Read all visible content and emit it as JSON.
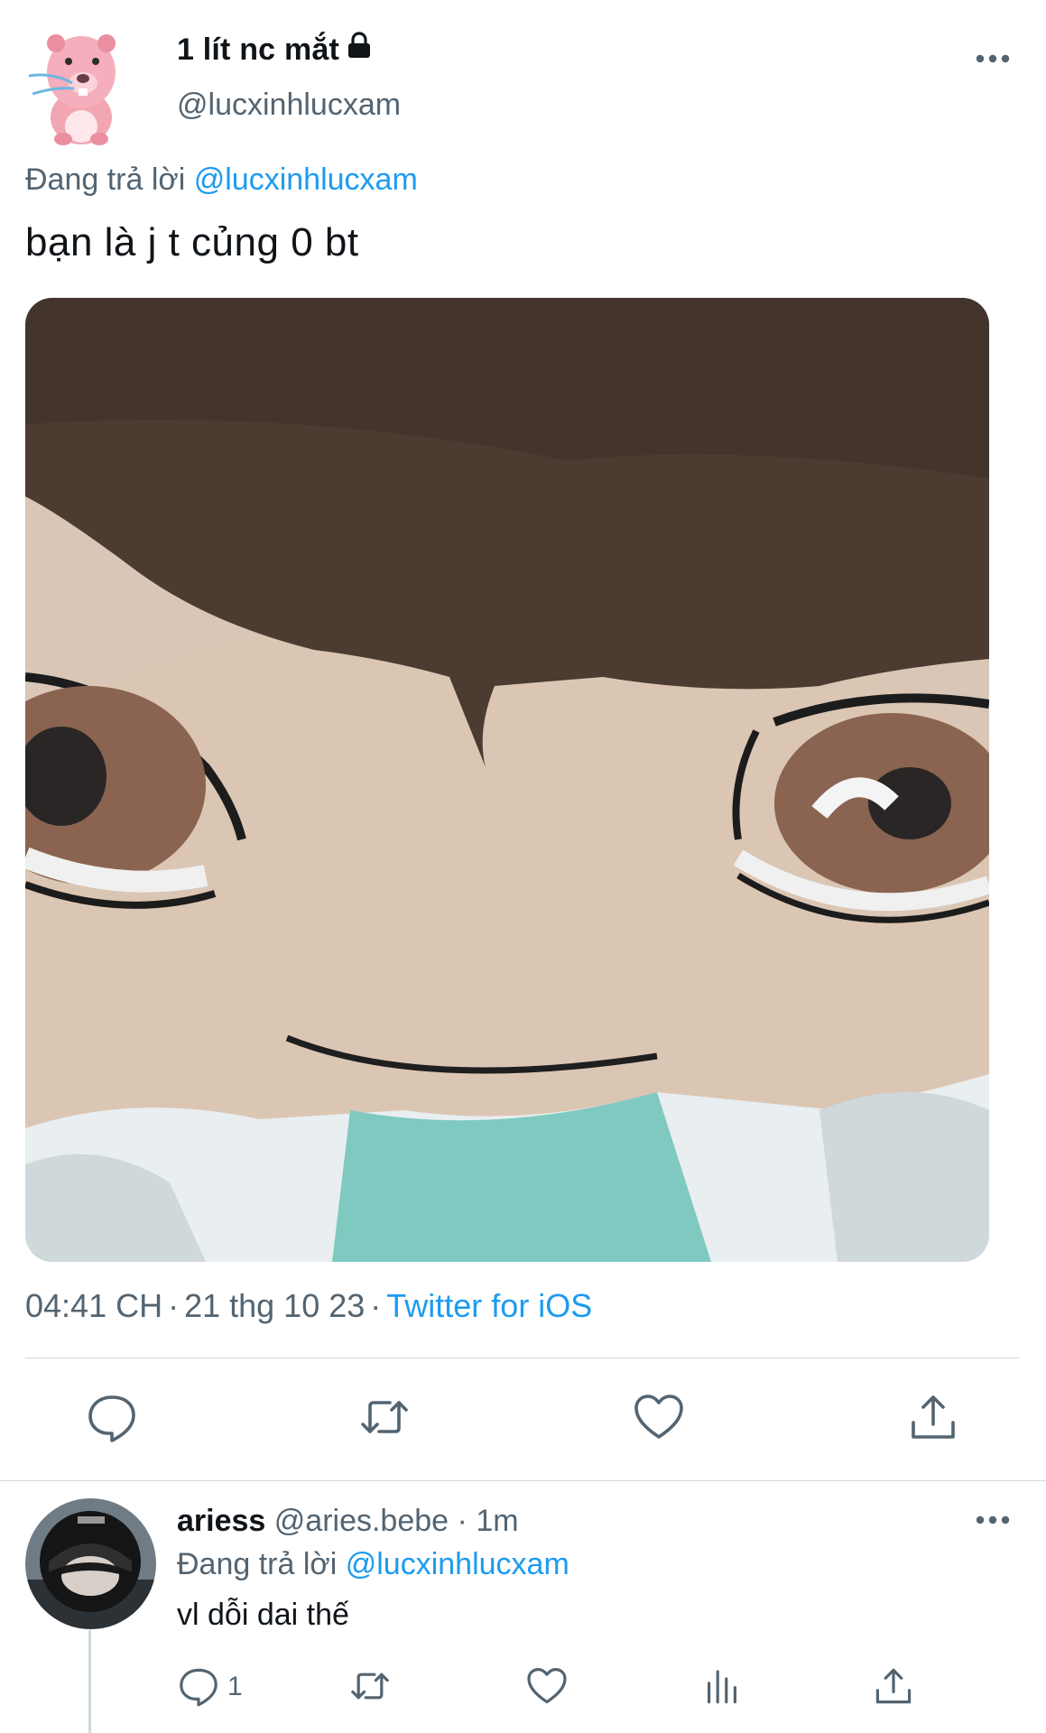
{
  "tweet": {
    "display_name": "1 lít nc mắt",
    "handle": "@lucxinhlucxam",
    "reply_prefix": "Đang trả lời",
    "reply_to": "@lucxinhlucxam",
    "text": "bạn là j t củng 0 bt",
    "time": "04:41 CH",
    "date": "21 thg 10 23",
    "source": "Twitter for iOS",
    "separator": "·"
  },
  "reply": {
    "display_name": "ariess",
    "handle": "@aries.bebe",
    "separator": "·",
    "time": "1m",
    "reply_prefix": "Đang trả lời",
    "reply_to": "@lucxinhlucxam",
    "text": "vl dỗi dai thế",
    "reply_count": "1"
  },
  "icons": {
    "lock": "lock-icon",
    "more": "more-icon",
    "reply": "reply-icon",
    "retweet": "retweet-icon",
    "like": "heart-icon",
    "share": "share-icon",
    "views": "views-icon"
  },
  "colors": {
    "link": "#1d9bf0",
    "muted": "#536471",
    "text": "#0f1419",
    "divider": "#cfd9de"
  }
}
